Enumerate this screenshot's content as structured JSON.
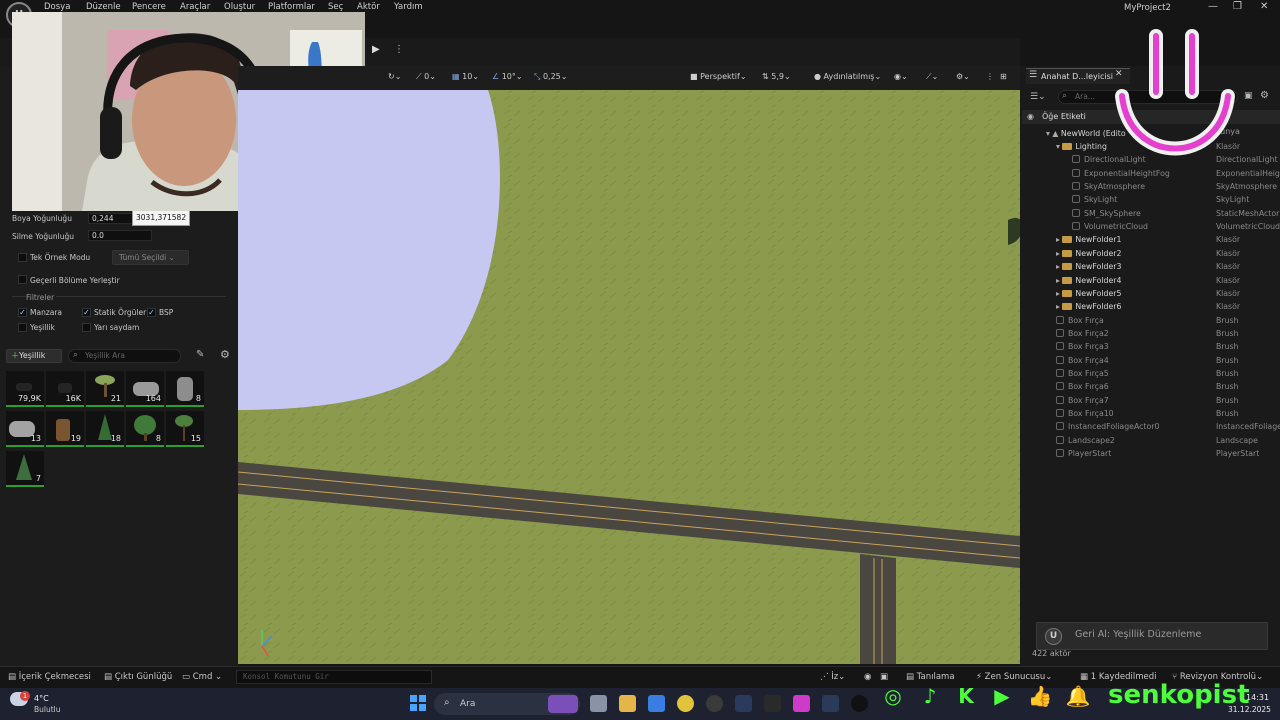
{
  "app": {
    "menu": [
      "Dosya",
      "Düzenle",
      "Pencere",
      "Araçlar",
      "Oluştur",
      "Platformlar",
      "Seç",
      "Aktör",
      "Yardım"
    ],
    "project_title": "MyProject2",
    "logo_text": "U",
    "window_controls": [
      "—",
      "❐",
      "✕"
    ]
  },
  "toolbar": {
    "play_label": "▶",
    "more_label": "⋮"
  },
  "viewport_toolbar": {
    "snap_rotate_value": "0",
    "grid_value": "10",
    "angle_value": "10°",
    "scale_value": "0,25",
    "view_mode": "Perspektif",
    "camera_speed": "5,9",
    "lighting_mode": "Aydınlatılmış"
  },
  "foliage_panel": {
    "paint_density_label": "Boya Yoğunluğu",
    "paint_density_value": "0,244",
    "tooltip_value": "3031,371582",
    "erase_density_label": "Silme Yoğunluğu",
    "erase_density_value": "0.0",
    "single_instance_label": "Tek Örnek Modu",
    "single_instance_dropdown": "Tümü Seçildi",
    "place_in_level_label": "Geçerli Bölüme Yerleştir",
    "filters_label": "Filtreler",
    "filters": [
      {
        "label": "Manzara",
        "checked": true
      },
      {
        "label": "Statik Örgüler",
        "checked": true
      },
      {
        "label": "BSP",
        "checked": true
      },
      {
        "label": "Yeşillik",
        "checked": false
      },
      {
        "label": "Yarı saydam",
        "checked": false
      }
    ],
    "add_button_label": "Yeşillik",
    "search_placeholder": "Yeşillik Ara",
    "tiles": [
      "79,9K",
      "16K",
      "21",
      "164",
      "8",
      "13",
      "19",
      "18",
      "8",
      "15",
      "7"
    ]
  },
  "outliner": {
    "tab_label": "Anahat D...leyicisi",
    "search_placeholder": "Ara...",
    "column_label": "Öğe Etiketi",
    "column_type_label": "Dünya",
    "world_label": "NewWorld (Edito",
    "rows": [
      {
        "name": "Lighting",
        "type": "Klasör",
        "kind": "folder",
        "indent": 1
      },
      {
        "name": "DirectionalLight",
        "type": "DirectionalLight",
        "kind": "actor",
        "indent": 2
      },
      {
        "name": "ExponentialHeightFog",
        "type": "ExponentialHeigh",
        "kind": "actor",
        "indent": 2
      },
      {
        "name": "SkyAtmosphere",
        "type": "SkyAtmosphere",
        "kind": "actor",
        "indent": 2
      },
      {
        "name": "SkyLight",
        "type": "SkyLight",
        "kind": "actor",
        "indent": 2
      },
      {
        "name": "SM_SkySphere",
        "type": "StaticMeshActor",
        "kind": "actor",
        "indent": 2
      },
      {
        "name": "VolumetricCloud",
        "type": "VolumetricCloud",
        "kind": "actor",
        "indent": 2
      },
      {
        "name": "NewFolder1",
        "type": "Klasör",
        "kind": "folder",
        "indent": 1
      },
      {
        "name": "NewFolder2",
        "type": "Klasör",
        "kind": "folder",
        "indent": 1
      },
      {
        "name": "NewFolder3",
        "type": "Klasör",
        "kind": "folder",
        "indent": 1
      },
      {
        "name": "NewFolder4",
        "type": "Klasör",
        "kind": "folder",
        "indent": 1
      },
      {
        "name": "NewFolder5",
        "type": "Klasör",
        "kind": "folder",
        "indent": 1
      },
      {
        "name": "NewFolder6",
        "type": "Klasör",
        "kind": "folder",
        "indent": 1
      },
      {
        "name": "Box Fırça",
        "type": "Brush",
        "kind": "actor",
        "indent": 1
      },
      {
        "name": "Box Fırça2",
        "type": "Brush",
        "kind": "actor",
        "indent": 1
      },
      {
        "name": "Box Fırça3",
        "type": "Brush",
        "kind": "actor",
        "indent": 1
      },
      {
        "name": "Box Fırça4",
        "type": "Brush",
        "kind": "actor",
        "indent": 1
      },
      {
        "name": "Box Fırça5",
        "type": "Brush",
        "kind": "actor",
        "indent": 1
      },
      {
        "name": "Box Fırça6",
        "type": "Brush",
        "kind": "actor",
        "indent": 1
      },
      {
        "name": "Box Fırça7",
        "type": "Brush",
        "kind": "actor",
        "indent": 1
      },
      {
        "name": "Box Fırça10",
        "type": "Brush",
        "kind": "actor",
        "indent": 1
      },
      {
        "name": "InstancedFoliageActor0",
        "type": "InstancedFoliage",
        "kind": "actor",
        "indent": 1
      },
      {
        "name": "Landscape2",
        "type": "Landscape",
        "kind": "actor",
        "indent": 1
      },
      {
        "name": "PlayerStart",
        "type": "PlayerStart",
        "kind": "actor",
        "indent": 1
      }
    ],
    "actor_count": "422 aktör"
  },
  "toast": {
    "message": "Geri Al: Yeşillik Düzenleme"
  },
  "statusbar": {
    "content_drawer": "İçerik Çekmecesi",
    "output_log": "Çıktı Günlüğü",
    "cmd_label": "Cmd",
    "cmd_placeholder": "Konsol Komutunu Gir",
    "diagnostics": "Tanılama",
    "zen_server": "Zen Sunucusu",
    "saved": "1 Kaydedilmedi",
    "revision": "Revizyon Kontrolü",
    "trace": "İz"
  },
  "taskbar": {
    "weather_temp": "4°C",
    "weather_desc": "Bulutlu",
    "weather_badge": "1",
    "search_label": "Ara",
    "time": "14:31",
    "date": "31.12.2025"
  },
  "overlay": {
    "brand": "senkopist"
  },
  "colors": {
    "ground": "#8b9a4d",
    "road": "#4a4640",
    "road_line": "#c9a35a",
    "water": "#c7c8f2",
    "accent_green": "#4cff3a",
    "smile_magenta": "#e53fcf"
  }
}
